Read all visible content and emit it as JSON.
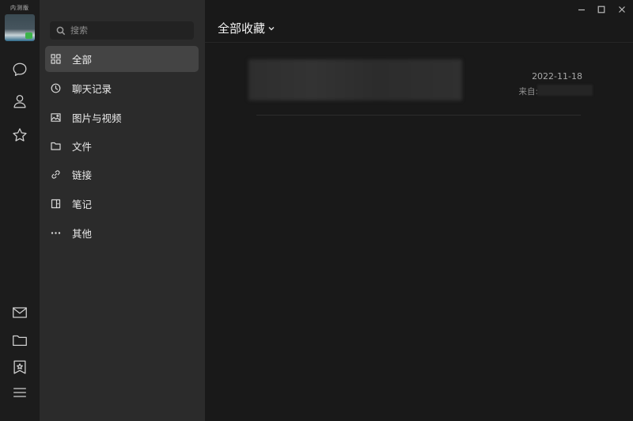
{
  "rail": {
    "edition_label": "内测版",
    "top_icons": [
      "chat-icon",
      "contacts-icon",
      "favorites-icon"
    ],
    "bottom_icons": [
      "mail-icon",
      "folder-icon",
      "bookmark-icon",
      "menu-icon"
    ]
  },
  "sidebar": {
    "search": {
      "placeholder": "搜索",
      "value": ""
    },
    "items": [
      {
        "label": "全部",
        "icon": "grid-icon",
        "active": true
      },
      {
        "label": "聊天记录",
        "icon": "clock-icon",
        "active": false
      },
      {
        "label": "图片与视频",
        "icon": "image-icon",
        "active": false
      },
      {
        "label": "文件",
        "icon": "folder-icon",
        "active": false
      },
      {
        "label": "链接",
        "icon": "link-icon",
        "active": false
      },
      {
        "label": "笔记",
        "icon": "note-icon",
        "active": false
      },
      {
        "label": "其他",
        "icon": "more-icon",
        "active": false
      }
    ]
  },
  "main": {
    "title": "全部收藏",
    "items": [
      {
        "date": "2022-11-18",
        "source_label": "来自:"
      }
    ]
  },
  "colors": {
    "rail_bg": "#1c1c1c",
    "sidebar_bg": "#2b2b2b",
    "main_bg": "#191919",
    "active_item_bg": "#444444"
  }
}
